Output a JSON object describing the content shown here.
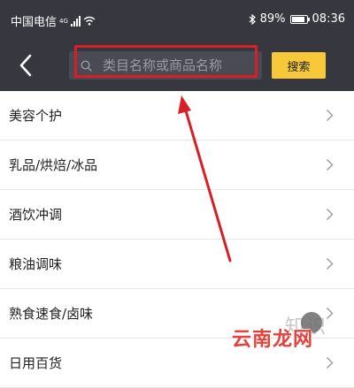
{
  "status_bar": {
    "carrier": "中国电信",
    "network": "4G",
    "battery": "89%",
    "battery_level": 0.89,
    "time": "08:36"
  },
  "nav": {
    "search_placeholder": "类目名称或商品名称",
    "search_button": "搜索"
  },
  "categories": [
    {
      "label": "美容个护"
    },
    {
      "label": "乳品/烘焙/冰品"
    },
    {
      "label": "酒饮冲调"
    },
    {
      "label": "粮油调味"
    },
    {
      "label": "熟食速食/卤味"
    },
    {
      "label": "日用百货"
    }
  ],
  "watermark": {
    "text": "云南龙网",
    "faint_text": "知识"
  },
  "colors": {
    "header_bg": "#37373f",
    "search_bg": "#4a4a54",
    "accent_yellow": "#f6c83a",
    "annotation_red": "#d91e26",
    "watermark_red": "#e8403b"
  }
}
